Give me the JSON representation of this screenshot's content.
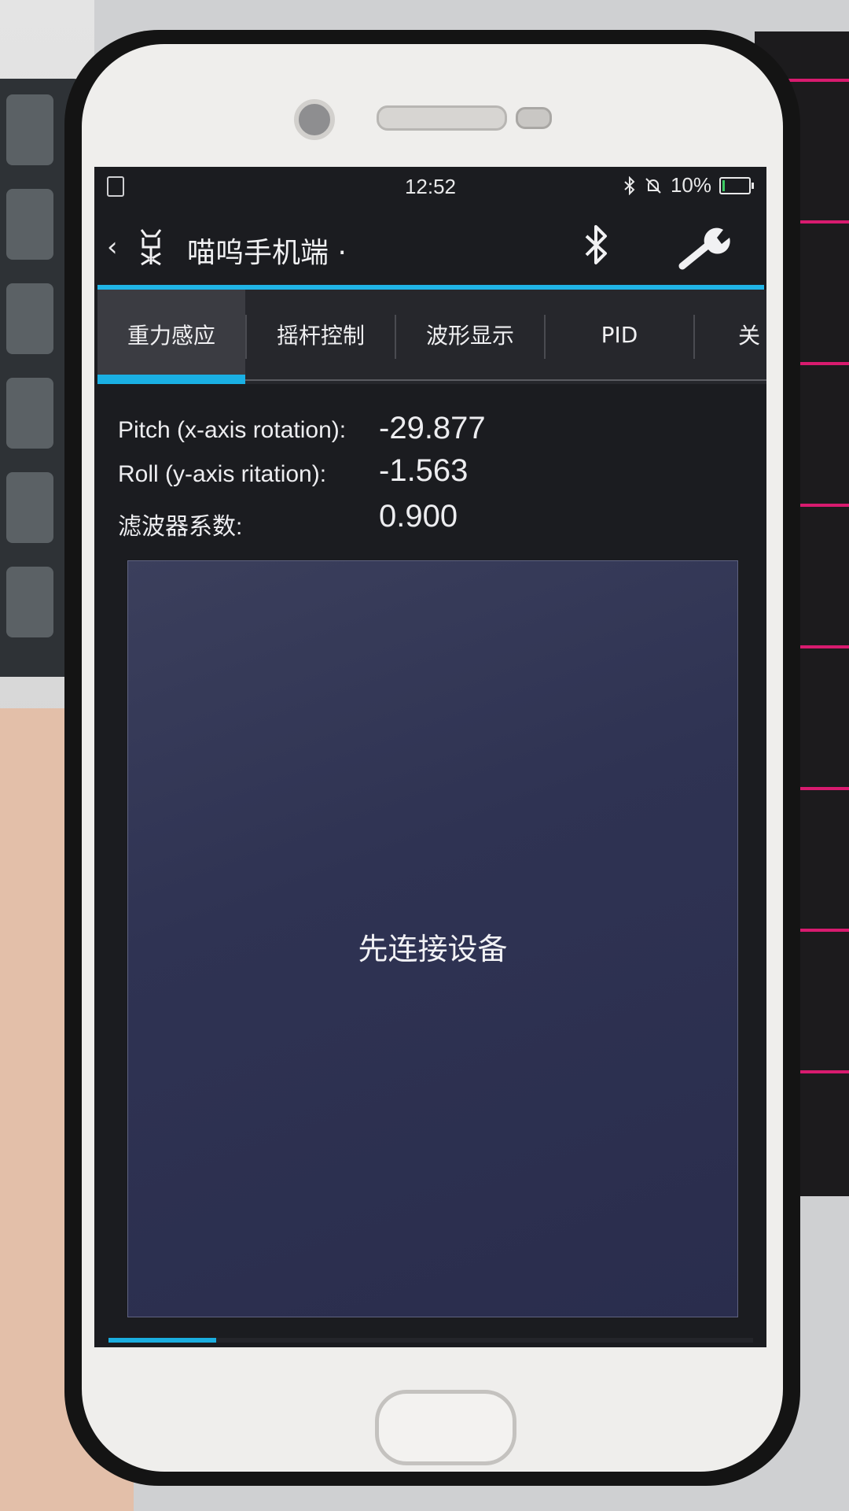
{
  "status_bar": {
    "time": "12:52",
    "battery_text": "10%",
    "battery_level": 0.1,
    "icons": [
      "copy-icon",
      "bluetooth-icon",
      "silent-bell-icon",
      "battery-charging-icon"
    ]
  },
  "app_bar": {
    "back_glyph": "‹",
    "title": "喵呜手机端",
    "title_dot": "·",
    "icons": [
      "back-icon",
      "app-logo-icon",
      "bluetooth-icon",
      "wrench-icon"
    ]
  },
  "tabs": [
    {
      "label": "重力感应",
      "active": true
    },
    {
      "label": "摇杆控制",
      "active": false
    },
    {
      "label": "波形显示",
      "active": false
    },
    {
      "label": "PID",
      "active": false
    },
    {
      "label": "关",
      "active": false
    }
  ],
  "readings": {
    "pitch_label": "Pitch (x-axis rotation):",
    "pitch_value": "-29.877",
    "roll_label": "Roll (y-axis ritation):",
    "roll_value": "-1.563",
    "filter_label": "滤波器系数:",
    "filter_value": "0.900"
  },
  "panel": {
    "message": "先连接设备"
  },
  "pager_progress": 0.167,
  "colors": {
    "accent": "#1ab0e4",
    "panel": "#2f3353",
    "background": "#1b1c20"
  }
}
